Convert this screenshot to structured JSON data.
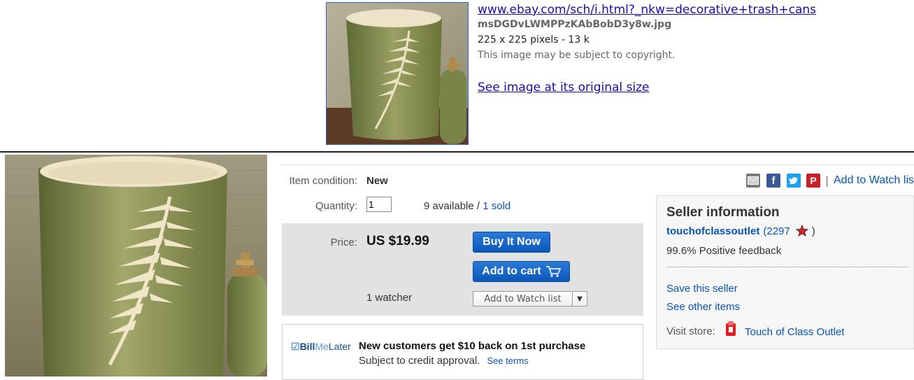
{
  "search_result": {
    "url": "www.ebay.com/sch/i.html?_nkw=decorative+trash+cans",
    "filename": "msDGDvLWMPPzKAbBobD3y8w.jpg",
    "dimensions": "225 x 225 pixels - 13 k",
    "copyright": "This image may be subject to copyright.",
    "original_size_link": "See image at its original size"
  },
  "listing": {
    "condition_label": "Item condition:",
    "condition_value": "New",
    "quantity_label": "Quantity:",
    "quantity_value": "1",
    "available": "9 available",
    "available_sep": " / ",
    "sold": "1 sold",
    "price_label": "Price:",
    "price_value": "US $19.99",
    "buy_now": "Buy It Now",
    "add_to_cart": "Add to cart",
    "watchers": "1 watcher",
    "add_to_watch": "Add to Watch list"
  },
  "bill_me_later": {
    "logo_bill": "Bill",
    "logo_me": "Me",
    "logo_later": "Later",
    "headline": "New customers get $10 back on 1st purchase",
    "subtext": "Subject to credit approval.",
    "terms": "See terms"
  },
  "share": {
    "icons": [
      "email-icon",
      "facebook-icon",
      "twitter-icon",
      "pinterest-icon"
    ],
    "separator": "|",
    "watch_link": "Add to Watch list"
  },
  "seller": {
    "title": "Seller information",
    "name": "touchofclassoutlet",
    "score_open": "(2297",
    "score_close": ")",
    "feedback": "99.6% Positive feedback",
    "save_seller": "Save this seller",
    "other_items": "See other items",
    "visit_store_label": "Visit store:",
    "store_name": "Touch of Class Outlet"
  },
  "colors": {
    "link": "#1a0dab",
    "ebay_link": "#0654ba",
    "button_blue": "#0b57b8",
    "price_box": "#e2e2e2"
  }
}
